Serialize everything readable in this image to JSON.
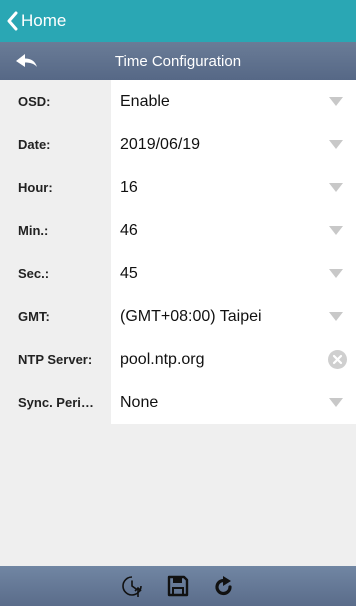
{
  "nav": {
    "back_label": "Home"
  },
  "header": {
    "title": "Time Configuration"
  },
  "fields": [
    {
      "label": "OSD:",
      "value": "Enable",
      "control": "dropdown"
    },
    {
      "label": "Date:",
      "value": "2019/06/19",
      "control": "dropdown"
    },
    {
      "label": "Hour:",
      "value": "16",
      "control": "dropdown"
    },
    {
      "label": "Min.:",
      "value": "46",
      "control": "dropdown"
    },
    {
      "label": "Sec.:",
      "value": "45",
      "control": "dropdown"
    },
    {
      "label": "GMT:",
      "value": "(GMT+08:00) Taipei",
      "control": "dropdown"
    },
    {
      "label": "NTP Server:",
      "value": "pool.ntp.org",
      "control": "text-clear"
    },
    {
      "label": "Sync. Peri…",
      "value": "None",
      "control": "dropdown"
    }
  ],
  "toolbar": {
    "icons": [
      "sync-time-icon",
      "save-icon",
      "refresh-icon"
    ]
  },
  "colors": {
    "topbar": "#2aa7b4",
    "header": "#5f7190",
    "background": "#efefef",
    "caret": "#c8c8c8"
  }
}
